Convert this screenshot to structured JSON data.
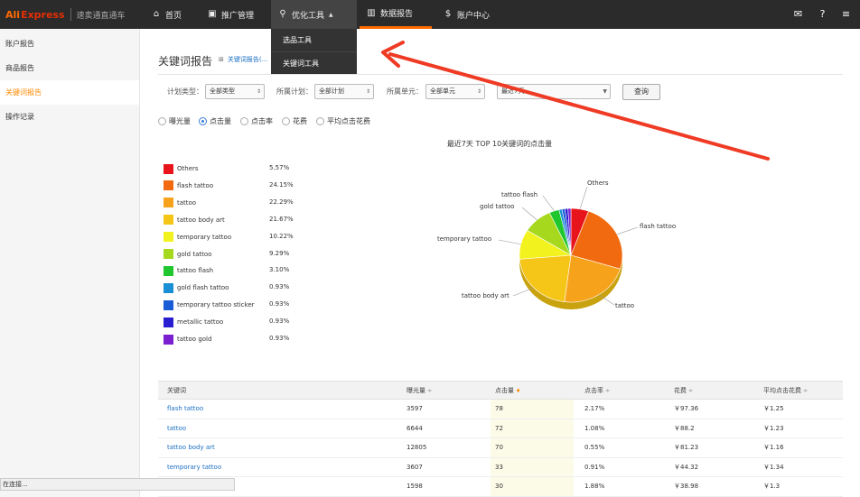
{
  "topbar": {
    "logo_ali": "Ali",
    "logo_express": "Express",
    "logo_sub": "速卖通直通车",
    "nav": [
      {
        "label": "首页",
        "icon": "home-icon"
      },
      {
        "label": "推广管理",
        "icon": "briefcase-icon"
      },
      {
        "label": "优化工具",
        "icon": "search-icon"
      },
      {
        "label": "数据报告",
        "icon": "bar-chart-icon"
      },
      {
        "label": "账户中心",
        "icon": "dollar-icon"
      }
    ],
    "right_icons": [
      "mail-icon",
      "help-icon",
      "menu-icon"
    ]
  },
  "dropdown": {
    "items": [
      "选品工具",
      "关键词工具"
    ]
  },
  "sidebar": {
    "items": [
      {
        "label": "账户报告",
        "active": false
      },
      {
        "label": "商品报告",
        "active": false
      },
      {
        "label": "关键词报告",
        "active": true
      },
      {
        "label": "操作记录",
        "active": false
      }
    ]
  },
  "status_text": "在连接...",
  "main": {
    "title": "关键词报告",
    "subnote": "关键词报告(...",
    "filters": [
      {
        "label": "计划类型：",
        "value": "全部类型"
      },
      {
        "label": "所属计划：",
        "value": "全部计划"
      },
      {
        "label": "所属单元：",
        "value": "全部单元"
      },
      {
        "label": "",
        "value": "最近7天"
      }
    ],
    "search_button": "查询",
    "metrics": [
      {
        "label": "曝光量",
        "selected": false
      },
      {
        "label": "点击量",
        "selected": true
      },
      {
        "label": "点击率",
        "selected": false
      },
      {
        "label": "花费",
        "selected": false
      },
      {
        "label": "平均点击花费",
        "selected": false
      }
    ]
  },
  "chart_data": {
    "type": "pie",
    "title": "最近7天 TOP 10关键词的点击量",
    "slices": [
      {
        "label": "Others",
        "value": 5.57,
        "color": "#e8141b"
      },
      {
        "label": "flash tattoo",
        "value": 24.15,
        "color": "#f26a10"
      },
      {
        "label": "tattoo",
        "value": 22.29,
        "color": "#f7a21b"
      },
      {
        "label": "tattoo body art",
        "value": 21.67,
        "color": "#f5c518"
      },
      {
        "label": "temporary tattoo",
        "value": 10.22,
        "color": "#f2f21e"
      },
      {
        "label": "gold tattoo",
        "value": 9.29,
        "color": "#a6d81e"
      },
      {
        "label": "tattoo flash",
        "value": 3.1,
        "color": "#1fc62e"
      },
      {
        "label": "gold flash tattoo",
        "value": 0.93,
        "color": "#1a8fd6"
      },
      {
        "label": "temporary tattoo sticker",
        "value": 0.93,
        "color": "#1a5bd6"
      },
      {
        "label": "metallic tattoo",
        "value": 0.93,
        "color": "#2a1fd0"
      },
      {
        "label": "tattoo gold",
        "value": 0.93,
        "color": "#7a1fd0"
      }
    ],
    "pct_labels": [
      "5.57%",
      "24.15%",
      "22.29%",
      "21.67%",
      "10.22%",
      "9.29%",
      "3.10%",
      "0.93%",
      "0.93%",
      "0.93%",
      "0.93%"
    ],
    "callouts": [
      "Others",
      "flash tattoo",
      "tattoo",
      "tattoo body art",
      "temporary tattoo",
      "gold tattoo",
      "tattoo flash"
    ]
  },
  "table": {
    "headers": [
      "关键词",
      "曝光量",
      "点击量",
      "点击率",
      "花费",
      "平均点击花费"
    ],
    "sort_marks": [
      "",
      "≑",
      "♦",
      "≑",
      "≑",
      "≑"
    ],
    "rows": [
      [
        "flash tattoo",
        "3597",
        "78",
        "2.17%",
        "￥97.36",
        "￥1.25"
      ],
      [
        "tattoo",
        "6644",
        "72",
        "1.08%",
        "￥88.2",
        "￥1.23"
      ],
      [
        "tattoo body art",
        "12805",
        "70",
        "0.55%",
        "￥81.23",
        "￥1.16"
      ],
      [
        "temporary tattoo",
        "3607",
        "33",
        "0.91%",
        "￥44.32",
        "￥1.34"
      ],
      [
        "",
        "1598",
        "30",
        "1.88%",
        "￥38.98",
        "￥1.3"
      ]
    ]
  }
}
